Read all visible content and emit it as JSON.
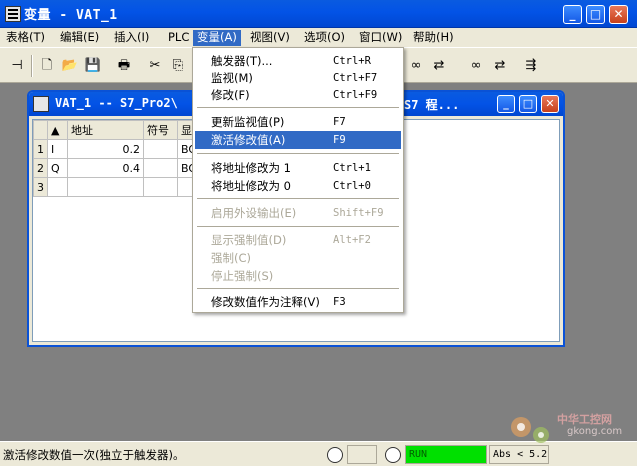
{
  "app": {
    "title": "变量 - VAT_1",
    "buttons": {
      "minimize": "_",
      "maximize": "□",
      "close": "✕"
    }
  },
  "menubar": {
    "items": [
      {
        "label": "表格(T)"
      },
      {
        "label": "编辑(E)"
      },
      {
        "label": "插入(I)"
      },
      {
        "label": "PLC"
      },
      {
        "label": "变量(A)"
      },
      {
        "label": "视图(V)"
      },
      {
        "label": "选项(O)"
      },
      {
        "label": "窗口(W)"
      },
      {
        "label": "帮助(H)"
      }
    ],
    "active": "变量(A)"
  },
  "child_window": {
    "title": "VAT_1 -- S7_Pro2\\",
    "title_right": "S7 程...",
    "table": {
      "headers": [
        "地址",
        "符号",
        "显"
      ],
      "rows": [
        {
          "num": "1",
          "addr": "I",
          "value": "0.2",
          "fmt": "BO"
        },
        {
          "num": "2",
          "addr": "Q",
          "value": "0.4",
          "fmt": "BO"
        },
        {
          "num": "3",
          "addr": "",
          "value": "",
          "fmt": ""
        }
      ]
    }
  },
  "dropdown": {
    "groups": [
      [
        {
          "label": "触发器(T)...",
          "shortcut": "Ctrl+R",
          "state": "normal"
        },
        {
          "label": "监视(M)",
          "shortcut": "Ctrl+F7",
          "state": "normal"
        },
        {
          "label": "修改(F)",
          "shortcut": "Ctrl+F9",
          "state": "normal"
        }
      ],
      [
        {
          "label": "更新监视值(P)",
          "shortcut": "F7",
          "state": "normal"
        },
        {
          "label": "激活修改值(A)",
          "shortcut": "F9",
          "state": "highlighted"
        }
      ],
      [
        {
          "label": "将地址修改为 1",
          "shortcut": "Ctrl+1",
          "state": "normal"
        },
        {
          "label": "将地址修改为 0",
          "shortcut": "Ctrl+0",
          "state": "normal"
        }
      ],
      [
        {
          "label": "启用外设输出(E)",
          "shortcut": "Shift+F9",
          "state": "disabled"
        }
      ],
      [
        {
          "label": "显示强制值(D)",
          "shortcut": "Alt+F2",
          "state": "disabled"
        },
        {
          "label": "强制(C)",
          "shortcut": "",
          "state": "disabled"
        },
        {
          "label": "停止强制(S)",
          "shortcut": "",
          "state": "disabled"
        }
      ],
      [
        {
          "label": "修改数值作为注释(V)",
          "shortcut": "F3",
          "state": "normal"
        }
      ]
    ]
  },
  "statusbar": {
    "text": "激活修改数值一次(独立于触发器)。",
    "run": "RUN",
    "abs": "Abs < 5.2"
  },
  "watermark": {
    "line1": "中华工控网",
    "line2": "gkong.com"
  },
  "colors": {
    "titlebar": "#0353e6",
    "highlight": "#316ac5",
    "run": "#00e000",
    "chrome": "#ece9d8"
  }
}
